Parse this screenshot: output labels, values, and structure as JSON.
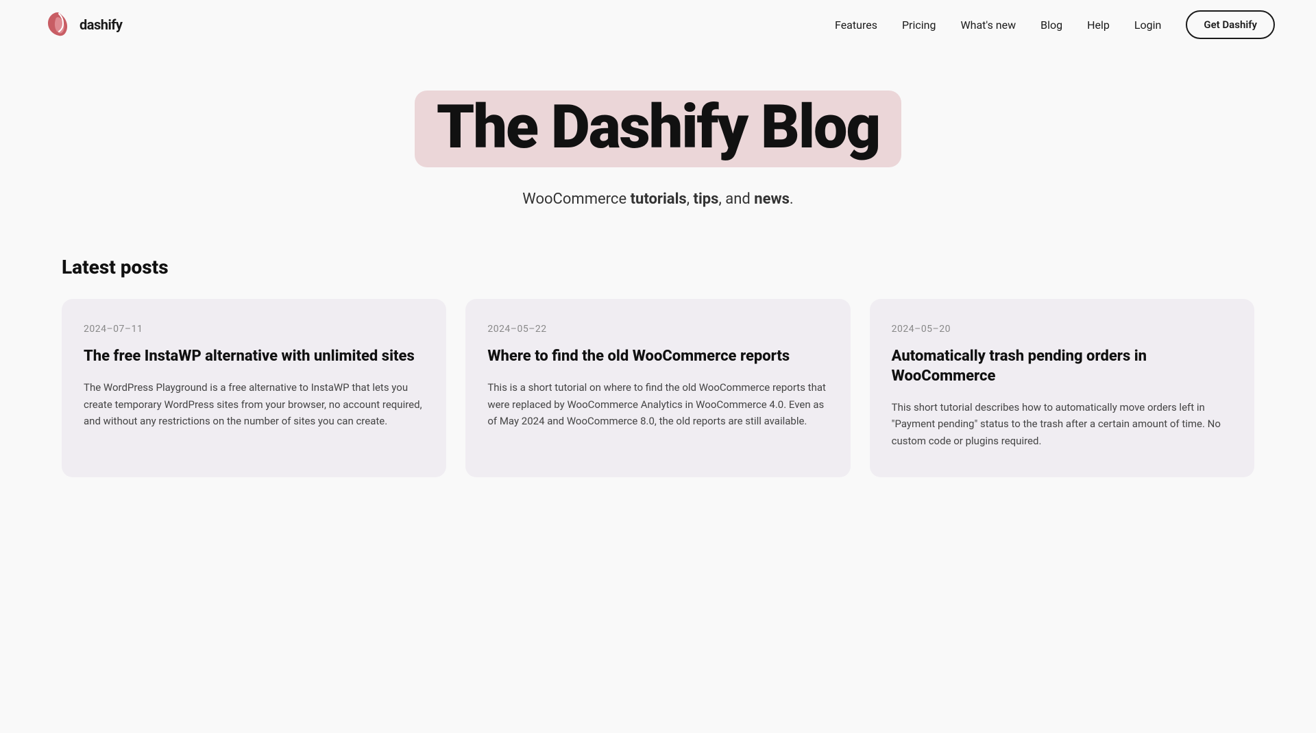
{
  "brand": {
    "name": "dashify",
    "logo_alt": "Dashify logo"
  },
  "nav": {
    "items": [
      {
        "label": "Features",
        "id": "features"
      },
      {
        "label": "Pricing",
        "id": "pricing"
      },
      {
        "label": "What's new",
        "id": "whats-new"
      },
      {
        "label": "Blog",
        "id": "blog"
      },
      {
        "label": "Help",
        "id": "help"
      },
      {
        "label": "Login",
        "id": "login"
      }
    ],
    "cta": "Get Dashify"
  },
  "hero": {
    "title": "The Dashify Blog",
    "subtitle_plain": "WooCommerce ",
    "subtitle_bold1": "tutorials",
    "subtitle_sep1": ", ",
    "subtitle_bold2": "tips",
    "subtitle_sep2": ", and ",
    "subtitle_bold3": "news",
    "subtitle_end": "."
  },
  "latest_posts": {
    "section_title": "Latest posts",
    "posts": [
      {
        "date": "2024–07–11",
        "title": "The free InstaWP alternative with unlimited sites",
        "excerpt": "The WordPress Playground is a free alternative to InstaWP that lets you create temporary WordPress sites from your browser, no account required, and without any restrictions on the number of sites you can create."
      },
      {
        "date": "2024–05–22",
        "title": "Where to find the old WooCommerce reports",
        "excerpt": "This is a short tutorial on where to find the old WooCommerce reports that were replaced by WooCommerce Analytics in WooCommerce 4.0. Even as of May 2024 and WooCommerce 8.0, the old reports are still available."
      },
      {
        "date": "2024–05–20",
        "title": "Automatically trash pending orders in WooCommerce",
        "excerpt": "This short tutorial describes how to automatically move orders left in \"Payment pending\" status to the trash after a certain amount of time. No custom code or plugins required."
      }
    ]
  }
}
